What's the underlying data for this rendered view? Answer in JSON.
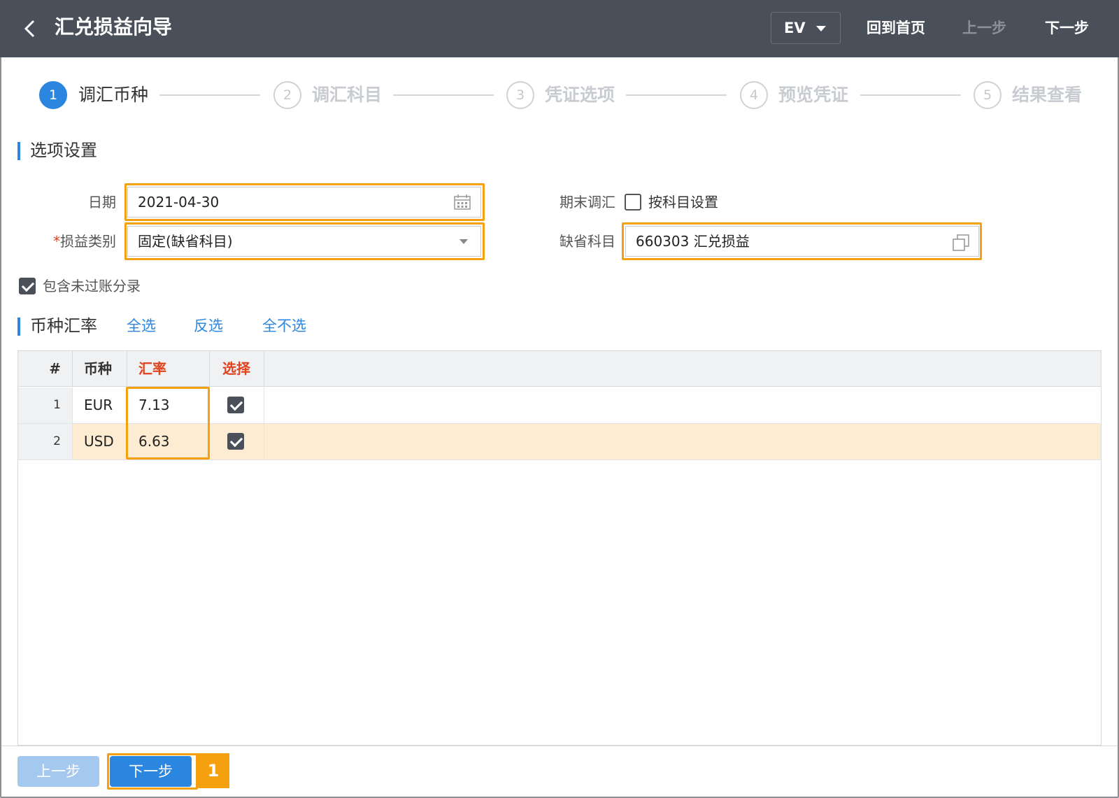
{
  "header": {
    "title": "汇兑损益向导",
    "org": "EV",
    "home": "回到首页",
    "prev": "上一步",
    "next": "下一步"
  },
  "steps": [
    {
      "num": "1",
      "label": "调汇币种"
    },
    {
      "num": "2",
      "label": "调汇科目"
    },
    {
      "num": "3",
      "label": "凭证选项"
    },
    {
      "num": "4",
      "label": "预览凭证"
    },
    {
      "num": "5",
      "label": "结果查看"
    }
  ],
  "options": {
    "section_title": "选项设置",
    "date_label": "日期",
    "date_value": "2021-04-30",
    "type_required_mark": "*",
    "type_label": "损益类别",
    "type_value": "固定(缺省科目)",
    "period_end_label": "期末调汇",
    "by_account_label": "按科目设置",
    "default_account_label": "缺省科目",
    "default_account_value": "660303 汇兑损益",
    "include_unposted_label": "包含未过账分录"
  },
  "rates": {
    "section_title": "币种汇率",
    "select_all": "全选",
    "invert": "反选",
    "select_none": "全不选",
    "columns": {
      "index": "#",
      "currency": "币种",
      "rate": "汇率",
      "select": "选择"
    },
    "rows": [
      {
        "index": "1",
        "currency": "EUR",
        "rate": "7.13",
        "checked": true
      },
      {
        "index": "2",
        "currency": "USD",
        "rate": "6.63",
        "checked": true
      }
    ]
  },
  "footer": {
    "prev": "上一步",
    "next": "下一步",
    "badge": "1"
  },
  "colors": {
    "header_bg": "#4a5059",
    "accent": "#2b86e0",
    "highlight": "#f5a00f",
    "selected_row": "#fdecd2",
    "required": "#e0421d"
  }
}
